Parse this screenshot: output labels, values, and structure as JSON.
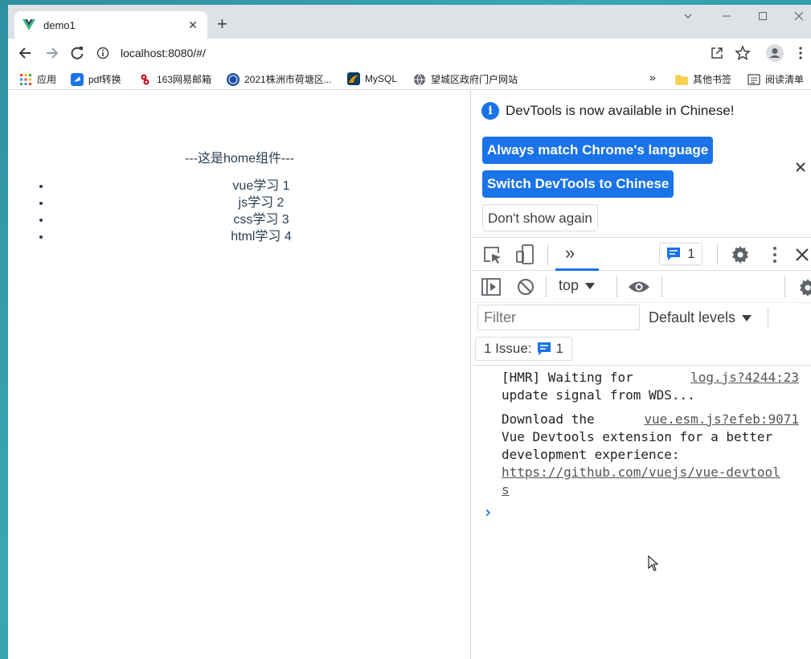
{
  "browser": {
    "tab_title": "demo1",
    "tab_close": "✕",
    "new_tab": "+",
    "url": "localhost:8080/#/"
  },
  "bookmarks": [
    {
      "label": "应用",
      "icon": "apps-grid-icon"
    },
    {
      "label": "pdf转换",
      "icon": "pdf-convert-icon"
    },
    {
      "label": "163网易邮箱",
      "icon": "netease-mail-icon"
    },
    {
      "label": "2021株洲市荷塘区...",
      "icon": "gov-site-icon"
    },
    {
      "label": "MySQL",
      "icon": "mysql-icon"
    },
    {
      "label": "望城区政府门户网站",
      "icon": "globe-icon"
    }
  ],
  "bookmarks_more": "»",
  "bookmarks_other": "其他书签",
  "bookmarks_reading": "阅读清单",
  "page": {
    "title": "---这是home组件---",
    "items": [
      "vue学习 1",
      "js学习 2",
      "css学习 3",
      "html学习 4"
    ]
  },
  "devtools": {
    "info_message": "DevTools is now available in Chinese!",
    "btn_match": "Always match Chrome's language",
    "btn_switch": "Switch DevTools to Chinese",
    "btn_dont_show": "Don't show again",
    "tabs_more": "»",
    "issues_badge_count": "1",
    "context": "top",
    "filter_placeholder": "Filter",
    "levels": "Default levels",
    "issue_label": "1 Issue:",
    "issue_count": "1",
    "messages": [
      {
        "text1": "[HMR] Waiting for",
        "text2": "update signal from WDS...",
        "source": "log.js?4244:23"
      },
      {
        "text1": "Download the",
        "text2": "Vue Devtools extension for a better",
        "text3": "development experience:",
        "link1": "https://github.com/vuejs/vue-devtool",
        "link2": "s",
        "source": "vue.esm.js?efeb:9071"
      }
    ],
    "prompt": "›"
  },
  "colors": {
    "accent": "#1a73e8",
    "vue_green": "#41b883",
    "vue_dark": "#34495e",
    "page_text": "#2c3e50"
  }
}
